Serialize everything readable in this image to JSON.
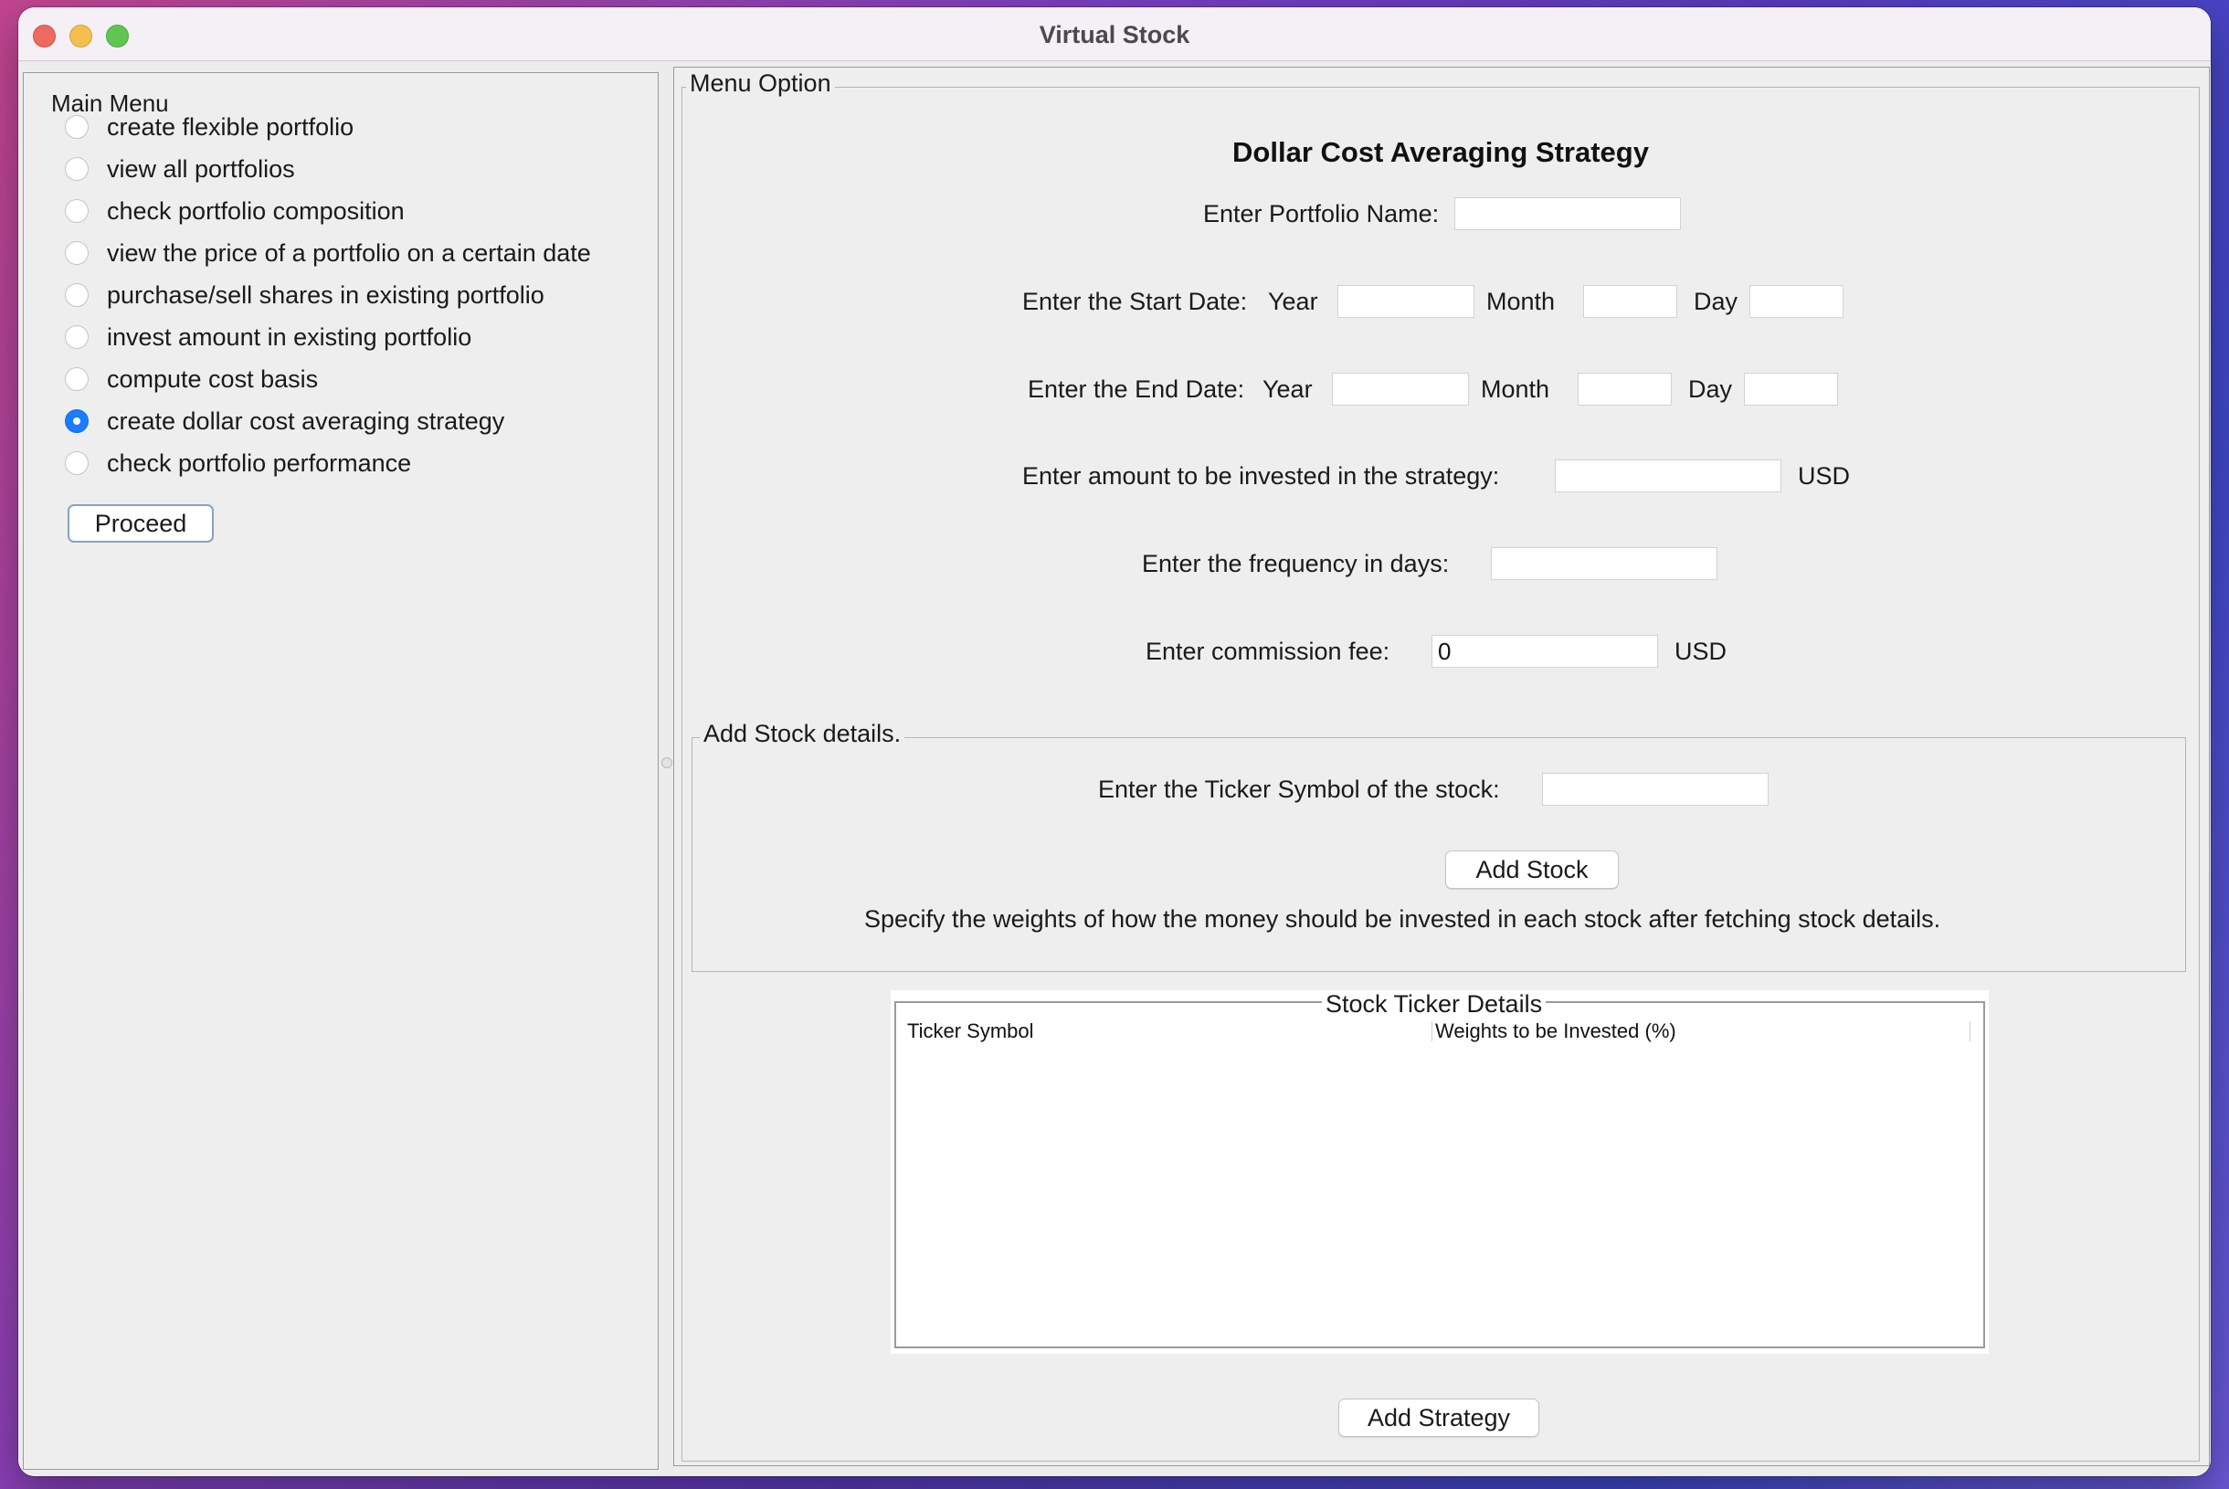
{
  "window": {
    "title": "Virtual Stock"
  },
  "sidebar": {
    "title": "Main Menu",
    "options": [
      {
        "label": "create flexible portfolio",
        "selected": false
      },
      {
        "label": "view all portfolios",
        "selected": false
      },
      {
        "label": "check portfolio composition",
        "selected": false
      },
      {
        "label": "view the price of a portfolio on a certain date",
        "selected": false
      },
      {
        "label": "purchase/sell shares in existing portfolio",
        "selected": false
      },
      {
        "label": "invest amount in existing portfolio",
        "selected": false
      },
      {
        "label": "compute cost basis",
        "selected": false
      },
      {
        "label": "create dollar cost averaging strategy",
        "selected": true
      },
      {
        "label": "check portfolio performance",
        "selected": false
      }
    ],
    "proceed_label": "Proceed"
  },
  "form": {
    "legend": "Menu Option",
    "heading": "Dollar Cost Averaging Strategy",
    "portfolio_name_label": "Enter Portfolio Name:",
    "portfolio_name_value": "",
    "start_date_label": "Enter the Start Date:",
    "end_date_label": "Enter the End Date:",
    "year_label": "Year",
    "month_label": "Month",
    "day_label": "Day",
    "start_year": "",
    "start_month": "",
    "start_day": "",
    "end_year": "",
    "end_month": "",
    "end_day": "",
    "amount_label": "Enter amount to be invested in the strategy:",
    "amount_value": "",
    "currency": "USD",
    "frequency_label": "Enter the frequency in days:",
    "frequency_value": "",
    "commission_label": "Enter commission fee:",
    "commission_value": "0"
  },
  "stock_section": {
    "legend": "Add Stock details.",
    "ticker_label": "Enter the Ticker Symbol of the stock:",
    "ticker_value": "",
    "add_stock_label": "Add Stock",
    "hint": "Specify the weights of how the money should be invested in each stock after fetching stock details."
  },
  "table": {
    "title": "Stock Ticker Details",
    "columns": [
      "Ticker Symbol",
      "Weights to be Invested (%)"
    ],
    "rows": []
  },
  "add_strategy_label": "Add Strategy",
  "colors": {
    "accent": "#1a7cff",
    "window_bg": "#ececec"
  }
}
